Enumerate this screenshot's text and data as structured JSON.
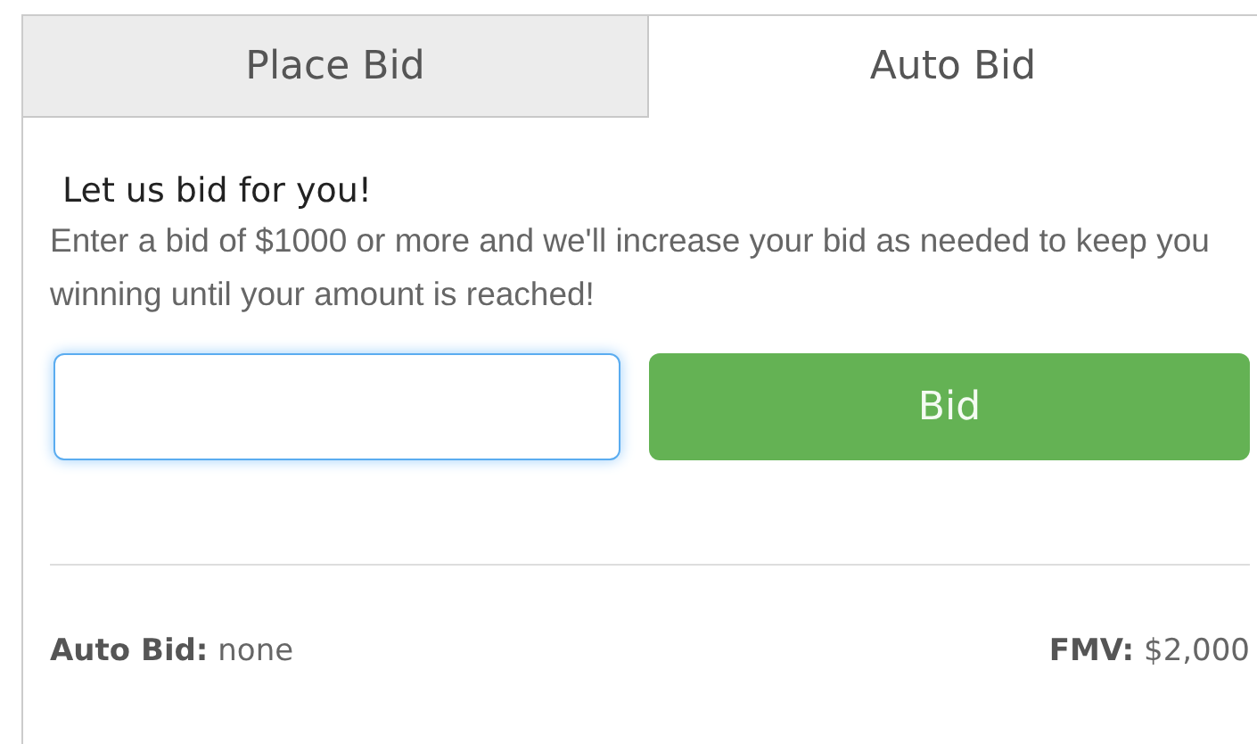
{
  "tabs": [
    {
      "label": "Place Bid",
      "selected": false
    },
    {
      "label": "Auto Bid",
      "selected": true
    }
  ],
  "heading": "Let us bid for you!",
  "description": "Enter a bid of $1000 or more and we'll increase your bid as needed to keep you winning until your amount is reached!",
  "bid_field": {
    "focused": true
  },
  "bid_button": "Bid",
  "footer": {
    "auto_bid": "**Auto Bid:** none",
    "fmv": "**FMV:** $2,000"
  }
}
